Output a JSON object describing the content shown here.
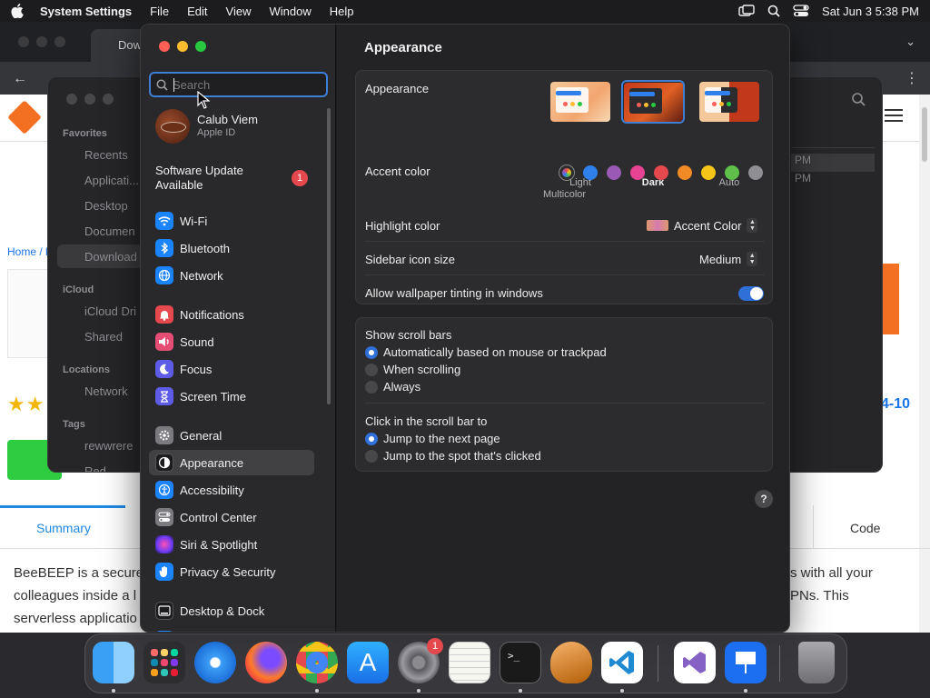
{
  "menubar": {
    "app_name": "System Settings",
    "menus": [
      "File",
      "Edit",
      "View",
      "Window",
      "Help"
    ],
    "clock": "Sat Jun 3  5:38 PM"
  },
  "browser": {
    "tab_title": "Dow",
    "breadcrumb": "Home / l",
    "version_text": "4-10",
    "tab_summary": "Summary",
    "tab_code": "Code",
    "desc_line1": "BeeBEEP is a secure",
    "desc_line2": "colleagues inside a l",
    "desc_line3": "serverless applicatio",
    "desc_right1": "s with all your",
    "desc_right2": "PNs. This"
  },
  "finder": {
    "sections": [
      "Favorites",
      "iCloud",
      "Locations",
      "Tags"
    ],
    "favorites": [
      "Recents",
      "Applicati...",
      "Desktop",
      "Documen",
      "Download"
    ],
    "icloud": [
      "iCloud Dri",
      "Shared"
    ],
    "locations": [
      "Network"
    ],
    "tags": [
      "rewwrere",
      "Red"
    ],
    "right_rows": [
      "PM",
      "PM"
    ]
  },
  "settings": {
    "search": {
      "placeholder": "Search",
      "value": ""
    },
    "user": {
      "name": "Calub Viem",
      "subtitle": "Apple ID"
    },
    "update": {
      "label": "Software Update Available",
      "badge": "1"
    },
    "nav": [
      {
        "label": "Wi-Fi",
        "icon": "wifi-icon",
        "color": "#1a84ff"
      },
      {
        "label": "Bluetooth",
        "icon": "bluetooth-icon",
        "color": "#1a84ff"
      },
      {
        "label": "Network",
        "icon": "globe-icon",
        "color": "#1a84ff"
      },
      {
        "label": "Notifications",
        "icon": "bell-icon",
        "color": "#e5484d"
      },
      {
        "label": "Sound",
        "icon": "speaker-icon",
        "color": "#e54d75"
      },
      {
        "label": "Focus",
        "icon": "moon-icon",
        "color": "#5e5ce6"
      },
      {
        "label": "Screen Time",
        "icon": "hourglass-icon",
        "color": "#5e5ce6"
      },
      {
        "label": "General",
        "icon": "gear-icon",
        "color": "#7a7a7f"
      },
      {
        "label": "Appearance",
        "icon": "appearance-icon",
        "color": "#1c1c1e"
      },
      {
        "label": "Accessibility",
        "icon": "accessibility-icon",
        "color": "#1a84ff"
      },
      {
        "label": "Control Center",
        "icon": "control-center-icon",
        "color": "#7a7a7f"
      },
      {
        "label": "Siri & Spotlight",
        "icon": "siri-icon",
        "color": "#b04ad8"
      },
      {
        "label": "Privacy & Security",
        "icon": "hand-icon",
        "color": "#1a84ff"
      },
      {
        "label": "Desktop & Dock",
        "icon": "dock-icon",
        "color": "#1c1c1e"
      }
    ],
    "selected_nav": "Appearance",
    "main": {
      "title": "Appearance",
      "appearance_label": "Appearance",
      "appearance_options": [
        "Light",
        "Dark",
        "Auto"
      ],
      "appearance_selected": "Dark",
      "accent_label": "Accent color",
      "accent_colors": [
        "#ffffff",
        "#2f80ed",
        "#9b59b6",
        "#e84393",
        "#e5484d",
        "#f08a24",
        "#f5c518",
        "#5fbf4a",
        "#8e8e93"
      ],
      "accent_caption": "Multicolor",
      "highlight_label": "Highlight color",
      "highlight_value": "Accent Color",
      "sidebar_icon_label": "Sidebar icon size",
      "sidebar_icon_value": "Medium",
      "wallpaper_tint_label": "Allow wallpaper tinting in windows",
      "wallpaper_tint_on": true,
      "scroll_bars_label": "Show scroll bars",
      "scroll_bar_options": [
        "Automatically based on mouse or trackpad",
        "When scrolling",
        "Always"
      ],
      "scroll_bar_selected": "Automatically based on mouse or trackpad",
      "click_label": "Click in the scroll bar to",
      "click_options": [
        "Jump to the next page",
        "Jump to the spot that's clicked"
      ],
      "click_selected": "Jump to the next page",
      "help": "?"
    }
  },
  "dock": {
    "apps": [
      "finder-icon",
      "launchpad-icon",
      "safari-icon",
      "firefox-icon",
      "chrome-icon",
      "app-store-icon",
      "system-settings-icon",
      "textedit-icon",
      "terminal-icon",
      "garageband-icon",
      "vscode-icon",
      "visual-studio-icon",
      "keynote-icon",
      "trash-icon"
    ],
    "settings_badge": "1"
  }
}
